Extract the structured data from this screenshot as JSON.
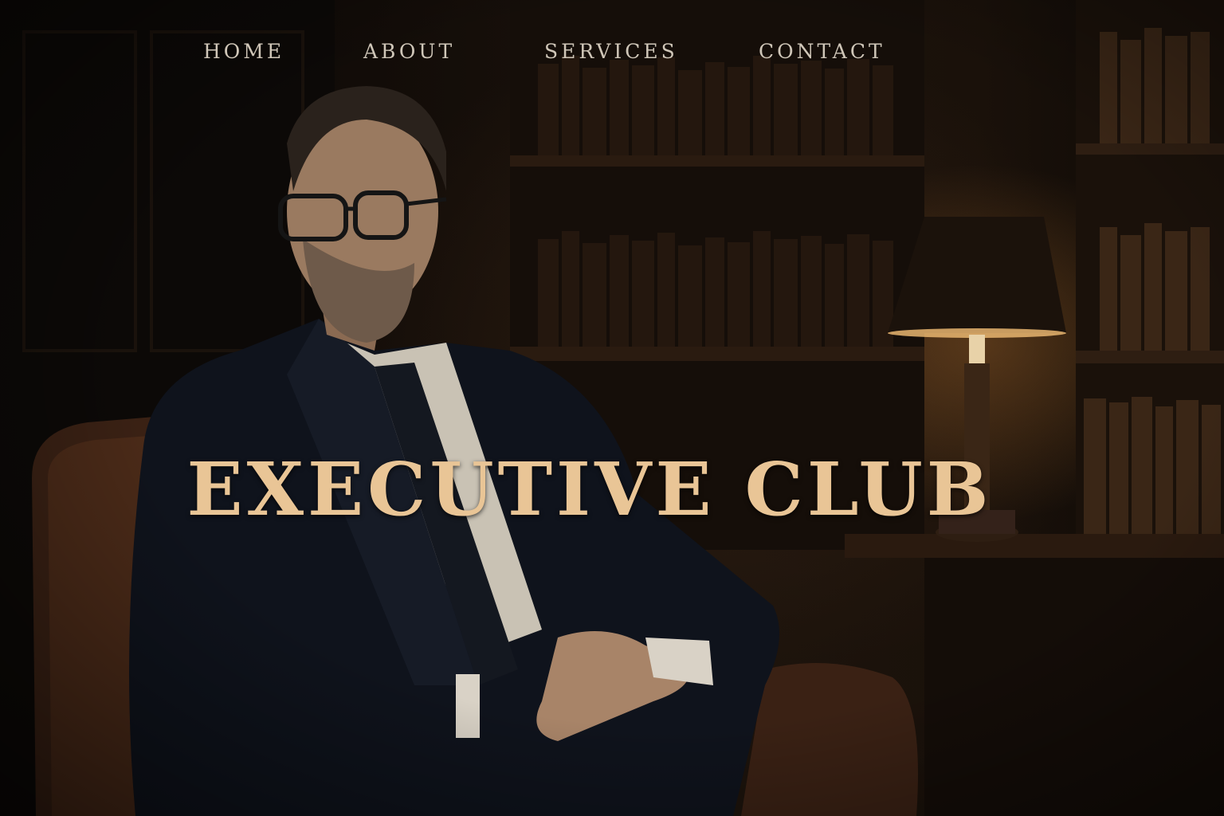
{
  "nav": {
    "items": [
      {
        "label": "HOME"
      },
      {
        "label": "ABOUT"
      },
      {
        "label": "SERVICES"
      },
      {
        "label": "CONTACT"
      }
    ]
  },
  "hero": {
    "title": "EXECUTIVE CLUB"
  },
  "colors": {
    "title": "#e9c596",
    "nav_text": "#cfc6b8",
    "background": "#0b0806"
  }
}
